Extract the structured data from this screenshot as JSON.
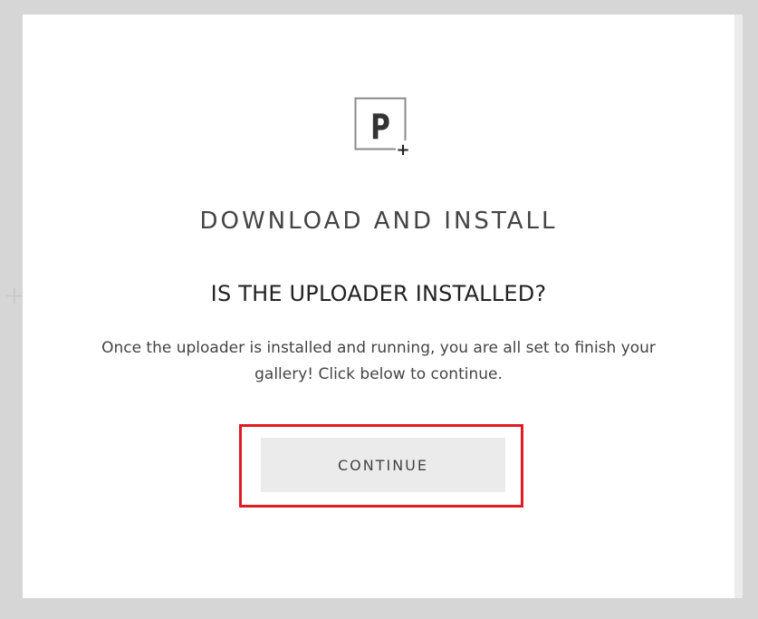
{
  "background": {
    "plus_symbol": "+"
  },
  "modal": {
    "logo": {
      "letter": "P",
      "badge": "+"
    },
    "heading": "DOWNLOAD AND INSTALL",
    "question": "IS THE UPLOADER INSTALLED?",
    "message": "Once the uploader is installed and running, you are all set to finish your gallery! Click below to continue.",
    "continue_label": "CONTINUE"
  },
  "colors": {
    "page_bg": "#d6d6d6",
    "modal_bg": "#ffffff",
    "button_bg": "#ebebeb",
    "highlight": "#e01b24",
    "text": "#444444"
  }
}
